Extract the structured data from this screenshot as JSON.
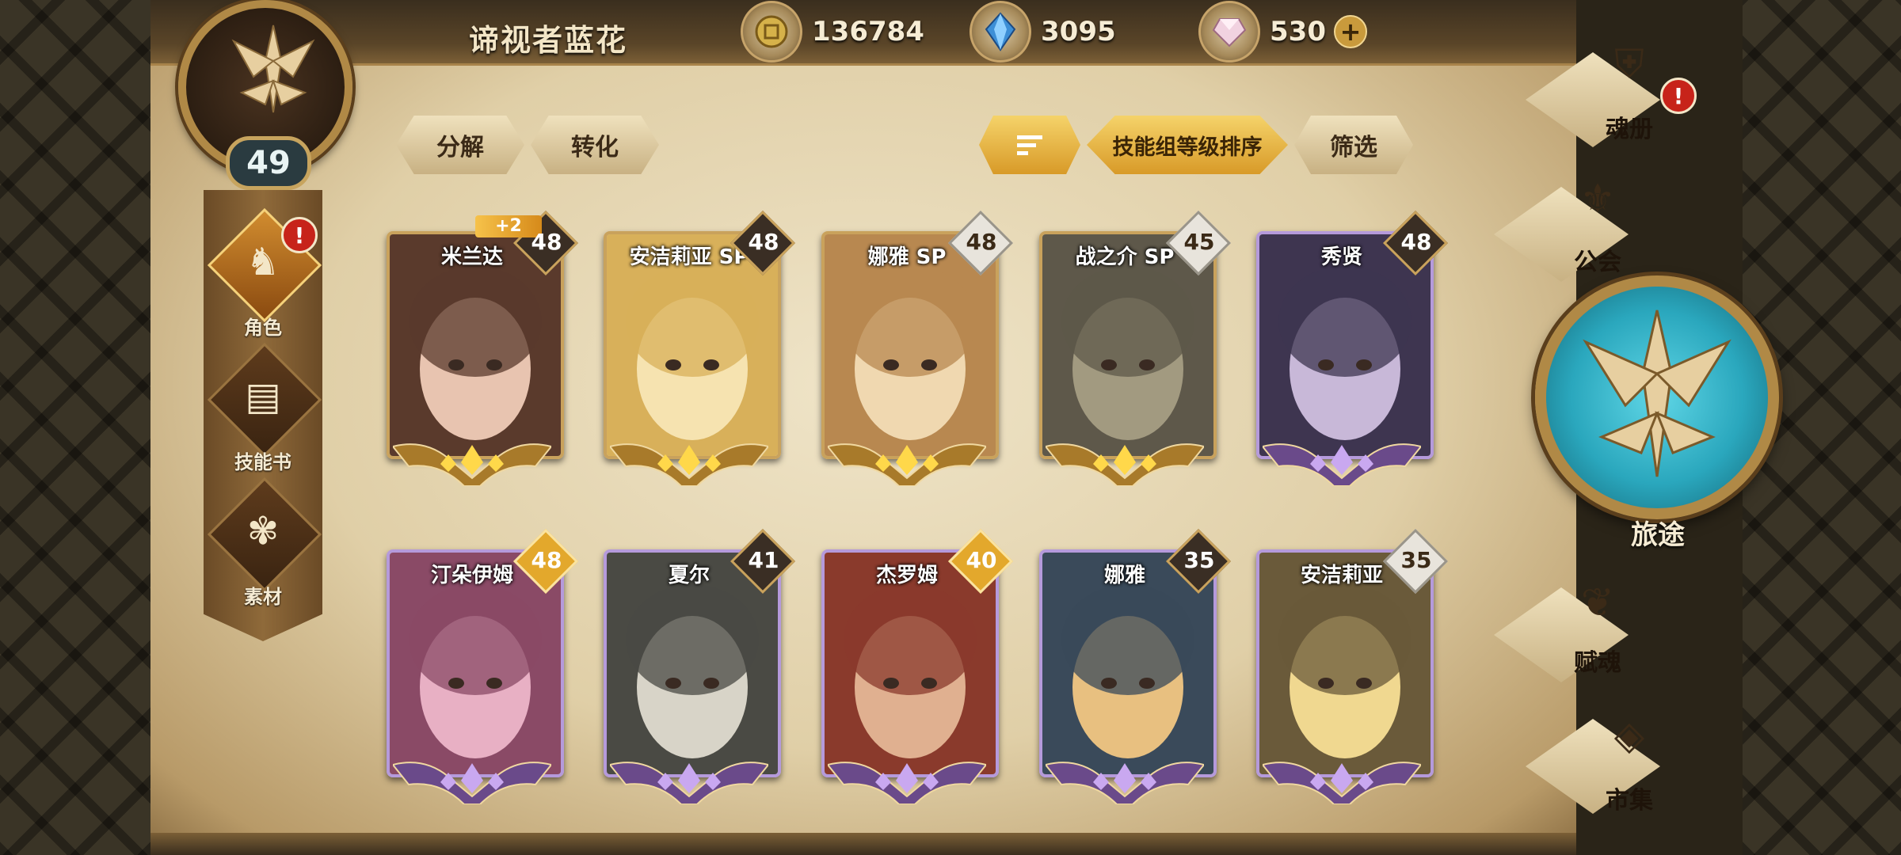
{
  "header": {
    "player_name": "谛视者蓝花",
    "level": "49",
    "gold": "136784",
    "crystal": "3095",
    "gem": "530",
    "plus": "+"
  },
  "left_nav": {
    "items": [
      {
        "label": "角色",
        "icon": "character-icon",
        "active": true,
        "alert": "!"
      },
      {
        "label": "技能书",
        "icon": "skill-book-icon",
        "active": false
      },
      {
        "label": "素材",
        "icon": "material-icon",
        "active": false
      }
    ]
  },
  "toolbar": {
    "decompose": "分解",
    "convert": "转化",
    "sort_by": "技能组等级排序",
    "filter": "筛选"
  },
  "heroes": [
    {
      "name": "米兰达",
      "level": "48",
      "bonus": "+2",
      "badge": "dark",
      "rarity": "gold"
    },
    {
      "name": "安洁莉亚 SP",
      "level": "48",
      "badge": "dark",
      "rarity": "gold"
    },
    {
      "name": "娜雅 SP",
      "level": "48",
      "badge": "silver",
      "rarity": "gold"
    },
    {
      "name": "战之介 SP",
      "level": "45",
      "badge": "silver",
      "rarity": "gold"
    },
    {
      "name": "秀贤",
      "level": "48",
      "badge": "dark",
      "rarity": "purple"
    },
    {
      "name": "汀朵伊姆",
      "level": "48",
      "badge": "gold",
      "rarity": "purple"
    },
    {
      "name": "夏尔",
      "level": "41",
      "badge": "dark",
      "rarity": "purple"
    },
    {
      "name": "杰罗姆",
      "level": "40",
      "badge": "gold",
      "rarity": "purple"
    },
    {
      "name": "娜雅",
      "level": "35",
      "badge": "dark",
      "rarity": "purple"
    },
    {
      "name": "安洁莉亚",
      "level": "35",
      "badge": "silver",
      "rarity": "purple"
    }
  ],
  "right_menu": {
    "soul_book": "魂册",
    "guild": "公会",
    "journey": "旅途",
    "endow_soul": "赋魂",
    "market": "市集",
    "alert": "!"
  },
  "colors": {
    "parchment": "#e8dab8",
    "gold": "#d89a28",
    "teal": "#2aa7bd",
    "alert": "#c7231a"
  }
}
